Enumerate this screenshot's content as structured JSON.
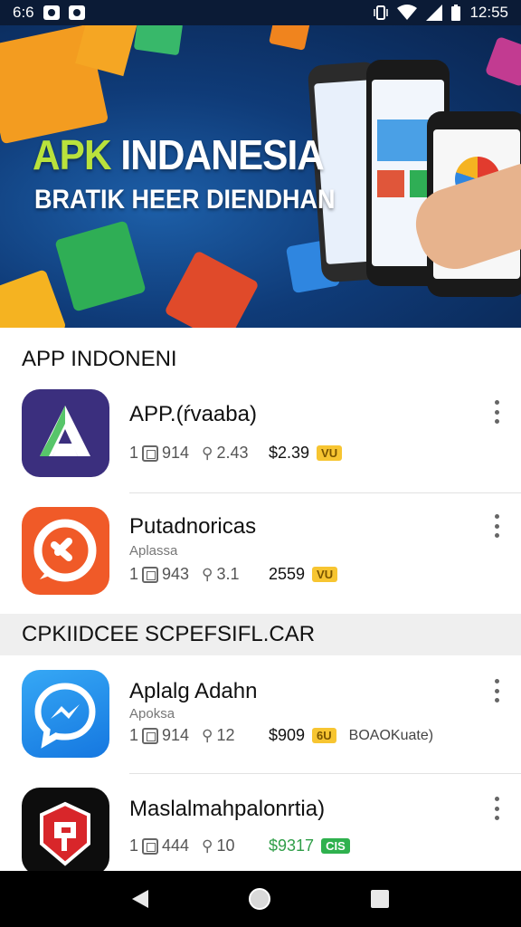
{
  "status_bar": {
    "left_text": "6:6",
    "time": "12:55",
    "icons": [
      "notification-icon",
      "notification-icon",
      "vibrate-icon",
      "wifi-icon",
      "signal-icon",
      "battery-icon"
    ]
  },
  "banner": {
    "title_part1": "APK",
    "title_part2": " INDANESIA",
    "subtitle": "BRATIK HEER DIENDHAN",
    "colors": {
      "background": "#0f3b78",
      "title_accent": "#b9e23c"
    }
  },
  "sections": [
    {
      "title": "APP INDONENI"
    },
    {
      "title": "CPKIIDCEE SCPEFSIFL.CAR"
    }
  ],
  "apps": [
    {
      "name": "APP.(ŕvaaba)",
      "subtitle": "",
      "downloads": "914",
      "rating": "2.43",
      "price": "$2.39",
      "badge": "VU",
      "badge_color": "#f7c531",
      "extra": "",
      "icon": "a-logo-icon"
    },
    {
      "name": "Putadnoricas",
      "subtitle": "Aplassa",
      "downloads": "943",
      "rating": "3.1",
      "price": "2559",
      "badge": "VU",
      "badge_color": "#f7c531",
      "extra": "",
      "icon": "chat-sync-icon"
    },
    {
      "name": "Aplalg Adahn",
      "subtitle": "Apoksa",
      "downloads": "914",
      "rating": "12",
      "price": "$909",
      "badge": "6U",
      "badge_color": "#f7c531",
      "extra": "BOAOKuate)",
      "icon": "messenger-icon"
    },
    {
      "name": "Maslalmahpalonrtia)",
      "subtitle": "",
      "downloads": "444",
      "rating": "10",
      "price": "$9317",
      "badge": "CIS",
      "badge_color": "#2fb14e",
      "extra": "",
      "icon": "shield-app-icon"
    }
  ],
  "nav_bar": {
    "buttons": [
      "back-icon",
      "home-icon",
      "recents-icon"
    ]
  }
}
